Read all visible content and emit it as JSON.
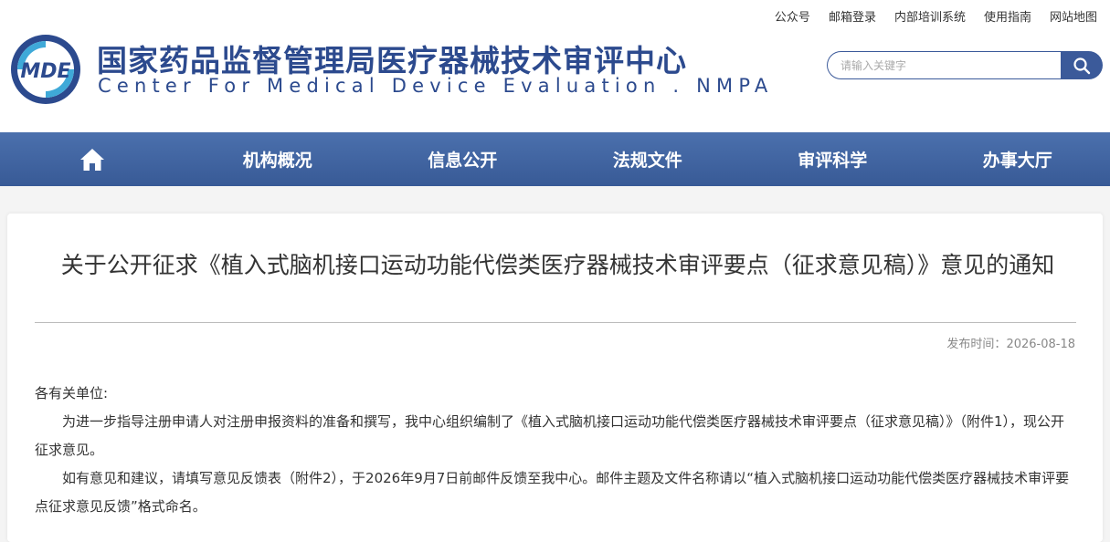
{
  "header": {
    "top_links": [
      "公众号",
      "邮箱登录",
      "内部培训系统",
      "使用指南",
      "网站地图"
    ],
    "logo": {
      "mark_text": "MDE",
      "cn_name": "国家药品监督管理局医疗器械技术审评中心",
      "en_name": "Center For Medical Device Evaluation . NMPA",
      "brand_color": "#2c4a8e"
    },
    "search": {
      "placeholder": "请输入关键字"
    }
  },
  "nav": {
    "items": [
      "机构概况",
      "信息公开",
      "法规文件",
      "审评科学",
      "办事大厅"
    ],
    "home_icon": "home-icon",
    "bg_color": "#3f62a0"
  },
  "article": {
    "title": "关于公开征求《植入式脑机接口运动功能代偿类医疗器械技术审评要点（征求意见稿）》意见的通知",
    "publish_label": "发布时间：",
    "publish_date": "2026-08-18",
    "salutation": "各有关单位:",
    "para1": "为进一步指导注册申请人对注册申报资料的准备和撰写，我中心组织编制了《植入式脑机接口运动功能代偿类医疗器械技术审评要点（征求意见稿）》（附件1），现公开征求意见。",
    "para2": "如有意见和建议，请填写意见反馈表（附件2），于2026年9月7日前邮件反馈至我中心。邮件主题及文件名称请以“植入式脑机接口运动功能代偿类医疗器械技术审评要点征求意见反馈”格式命名。"
  }
}
